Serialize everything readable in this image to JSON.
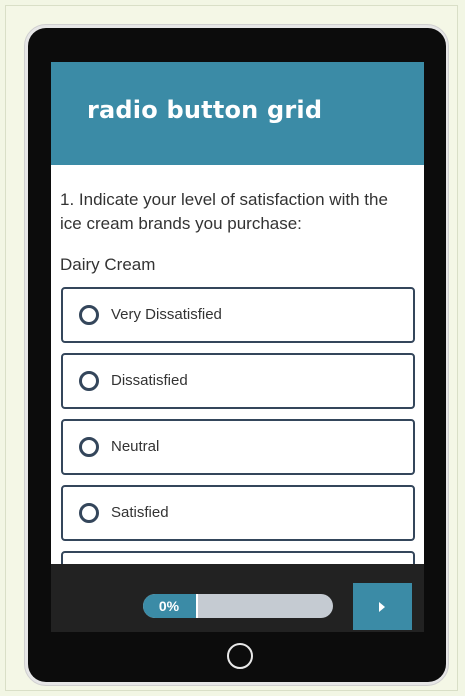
{
  "header": {
    "title": "radio button grid"
  },
  "question": {
    "text": "1. Indicate your level of satisfaction with the ice cream brands you purchase:"
  },
  "row": {
    "label": "Dairy Cream"
  },
  "options": [
    {
      "label": "Very Dissatisfied"
    },
    {
      "label": "Dissatisfied"
    },
    {
      "label": "Neutral"
    },
    {
      "label": "Satisfied"
    }
  ],
  "footer": {
    "progress_text": "0%",
    "progress_value": 0,
    "next_icon": "play-arrow-icon"
  },
  "colors": {
    "accent": "#3b8ba6",
    "option_border": "#34465b",
    "device": "#0c0c0c",
    "footer": "#222222"
  }
}
